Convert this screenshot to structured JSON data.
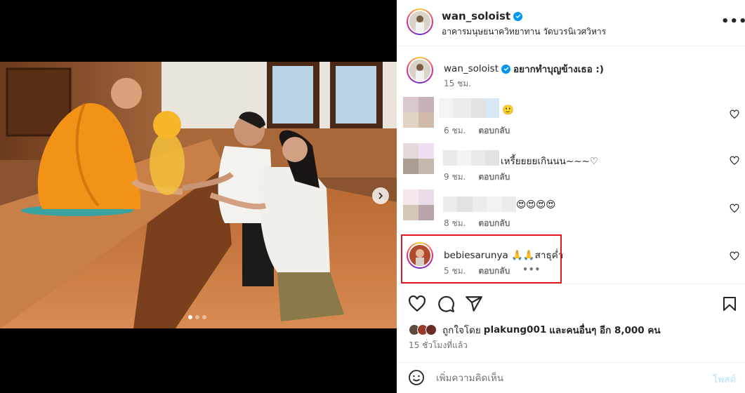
{
  "post": {
    "author": "wan_soloist",
    "location": "อาคารมนุษยนาควิทยาทาน วัดบวรนิเวศวิหาร",
    "more_icon": "more-horizontal-icon",
    "more_label": "•••"
  },
  "caption": {
    "author": "wan_soloist",
    "text": "อยากทำบุญข้างเธอ :)",
    "time": "15 ชม."
  },
  "comments": [
    {
      "author": "",
      "text": "🙂",
      "time": "6 ชม.",
      "reply_label": "ตอบกลับ",
      "blurred": true
    },
    {
      "author": "",
      "text": "เหรี้ยยยยเกินนน~~~♡",
      "time": "9 ชม.",
      "reply_label": "ตอบกลับ",
      "blurred": true
    },
    {
      "author": "",
      "text": "😍😍😍😍",
      "time": "8 ชม.",
      "reply_label": "ตอบกลับ",
      "blurred": true
    },
    {
      "author": "bebiesarunya",
      "text": "🙏🙏สาธุค่ำ",
      "time": "5 ชม.",
      "reply_label": "ตอบกลับ",
      "more_label": "•••",
      "blurred": false,
      "highlighted": true
    }
  ],
  "likes": {
    "prefix": "ถูกใจโดย",
    "user": "plakung001",
    "suffix": "และคนอื่นๆ อีก 8,000 คน"
  },
  "posted_time": "15 ชั่วโมงที่แล้ว",
  "add_comment": {
    "placeholder": "เพิ่มความคิดเห็น",
    "post_label": "โพสต์"
  },
  "carousel": {
    "slides": 3,
    "active": 0
  },
  "colors": {
    "accent": "#0095f6",
    "highlight_border": "#e1161f",
    "post_disabled": "#b2dffc"
  }
}
